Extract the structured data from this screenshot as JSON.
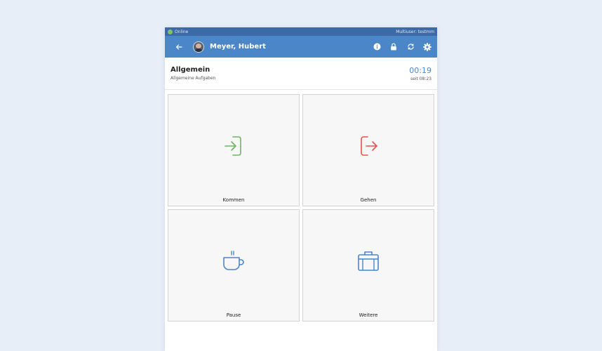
{
  "status": {
    "online_label": "Online",
    "user_tag": "Multiuser: testmm"
  },
  "header": {
    "user_name": "Meyer, Hubert"
  },
  "section": {
    "title": "Allgemein",
    "subtitle": "Allgemeine Aufgaben",
    "time": "00:19",
    "since": "seit 08:23"
  },
  "tiles": [
    {
      "label": "Kommen",
      "icon": "login-icon",
      "color": "#6cb85f"
    },
    {
      "label": "Gehen",
      "icon": "logout-icon",
      "color": "#e5534b"
    },
    {
      "label": "Pause",
      "icon": "coffee-cup-icon",
      "color": "#4a86c8"
    },
    {
      "label": "Weitere",
      "icon": "briefcase-icon",
      "color": "#4a86c8"
    }
  ],
  "colors": {
    "statusbar": "#3c6aa8",
    "appbar": "#4a86c8",
    "online": "#7cc36a",
    "background": "#e8eef8"
  }
}
